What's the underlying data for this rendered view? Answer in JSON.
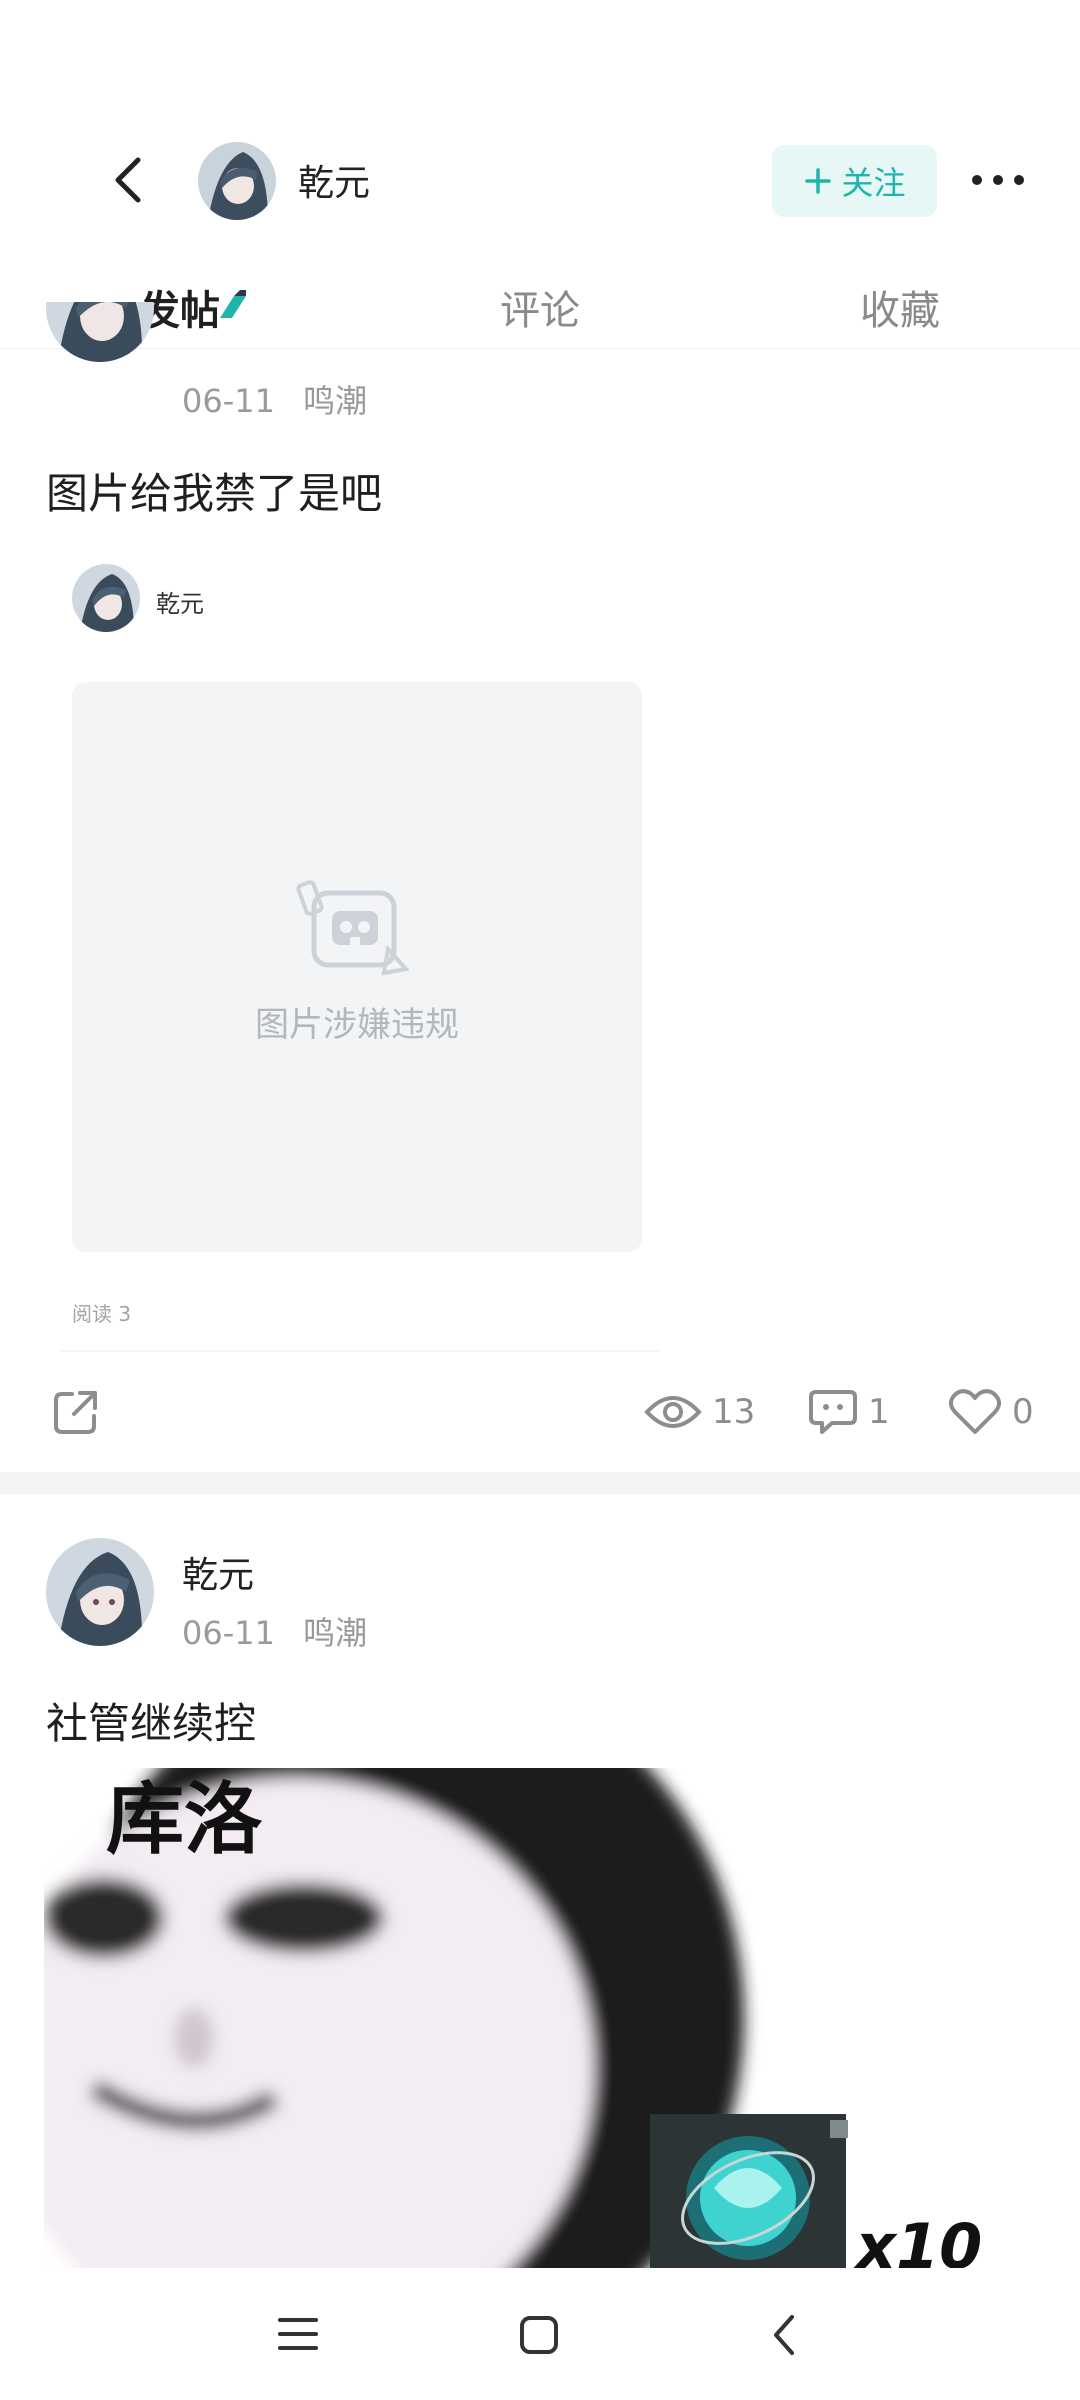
{
  "header": {
    "user_name": "乾元",
    "follow_label": "关注"
  },
  "tabs": [
    {
      "label": "发帖",
      "active": true
    },
    {
      "label": "评论",
      "active": false
    },
    {
      "label": "收藏",
      "active": false
    }
  ],
  "posts": [
    {
      "author": "乾元",
      "date": "06-11",
      "game": "鸣潮",
      "text": "图片给我禁了是吧",
      "embedded": {
        "author": "乾元",
        "blocked_text": "图片涉嫌违规",
        "read_label": "阅读 3"
      },
      "stats": {
        "views": "13",
        "comments": "1",
        "likes": "0"
      }
    },
    {
      "author": "乾元",
      "date": "06-11",
      "game": "鸣潮",
      "text": "社管继续控",
      "image": {
        "caption": "库洛",
        "multiplier": "x10"
      }
    }
  ],
  "colors": {
    "accent": "#1fb5ab",
    "follow_bg": "#e6f7f6",
    "muted": "#9a9a9a"
  },
  "icons": [
    "chevron-left-icon",
    "more-dots-icon",
    "share-icon",
    "eye-icon",
    "comment-icon",
    "heart-icon",
    "menu-icon",
    "home-square-icon",
    "back-triangle-icon"
  ]
}
